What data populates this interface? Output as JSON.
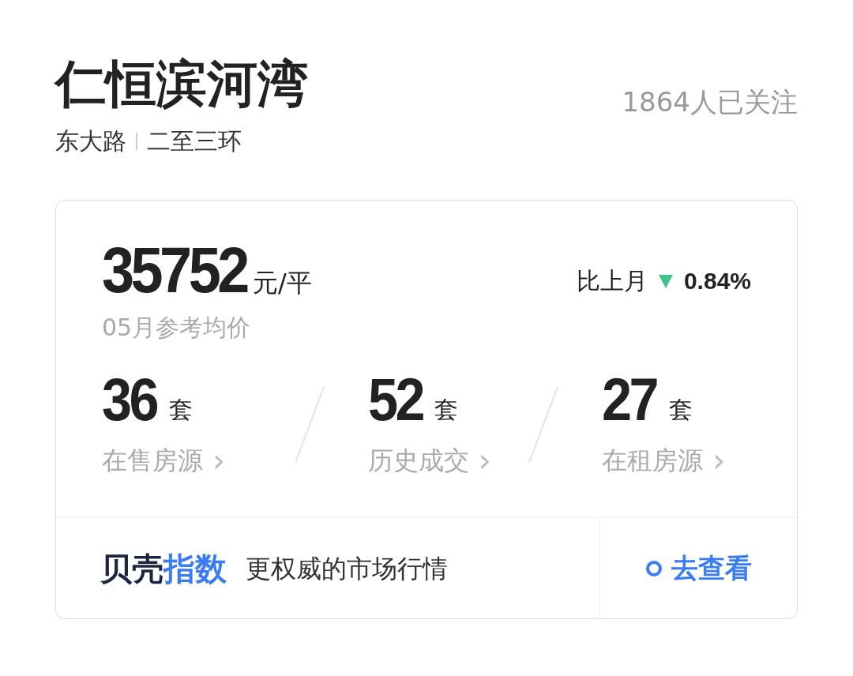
{
  "community": {
    "name": "仁恒滨河湾",
    "road": "东大路",
    "ring": "二至三环",
    "followers": "1864人已关注"
  },
  "price": {
    "value": "35752",
    "unit": "元/平",
    "caption": "05月参考均价",
    "compare_label": "比上月",
    "rising": false,
    "change": "0.84%"
  },
  "stats": [
    {
      "count": "36",
      "unit": "套",
      "label": "在售房源",
      "chevron": "›"
    },
    {
      "count": "52",
      "unit": "套",
      "label": "历史成交",
      "chevron": "›"
    },
    {
      "count": "27",
      "unit": "套",
      "label": "在租房源",
      "chevron": "›"
    }
  ],
  "index_banner": {
    "logo_dark": "贝壳",
    "logo_blue": "指数",
    "tagline": "更权威的市场行情",
    "link": "去查看"
  }
}
